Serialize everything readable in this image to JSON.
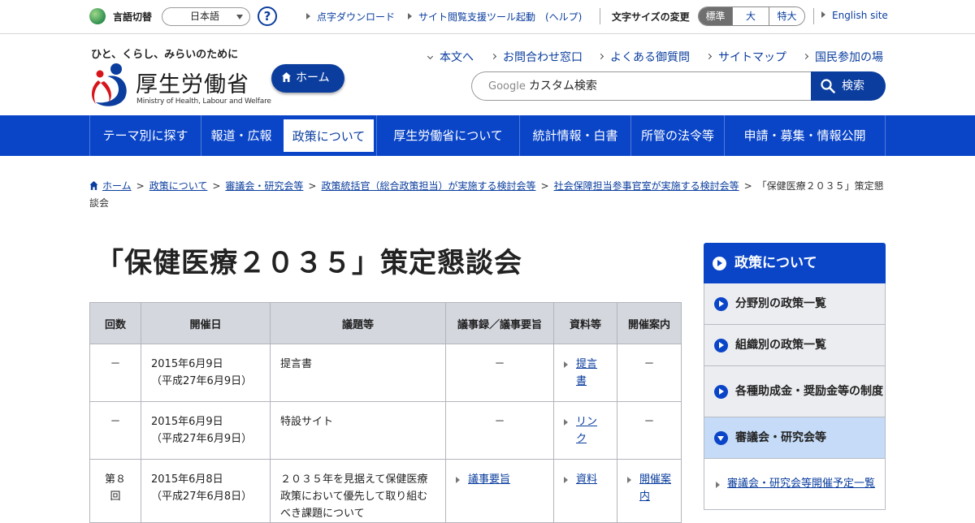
{
  "utility": {
    "language_label": "言語切替",
    "language_selected": "日本語",
    "help_symbol": "?",
    "links": [
      "点字ダウンロード",
      "サイト閲覧支援ツール起動　(ヘルプ)"
    ],
    "font_size_label": "文字サイズの変更",
    "font_sizes": [
      "標準",
      "大",
      "特大"
    ],
    "english_site": "English site"
  },
  "header": {
    "tagline": "ひと、くらし、みらいのために",
    "logo_jp": "厚生労働省",
    "logo_en": "Ministry of Health, Labour and Welfare",
    "home_button": "ホーム",
    "links": [
      "本文へ",
      "お問合わせ窓口",
      "よくある御質問",
      "サイトマップ",
      "国民参加の場"
    ],
    "search_brand": "Google",
    "search_value": "カスタム検索",
    "search_button": "検索"
  },
  "colors": {
    "primary": "#0a45c8",
    "dark_blue": "#0a3d9e",
    "table_header": "#d5d7df",
    "side_open": "#c5dbf7"
  },
  "nav": [
    "テーマ別に探す",
    "報道・広報",
    "政策について",
    "厚生労働省について",
    "統計情報・白書",
    "所管の法令等",
    "申請・募集・情報公開"
  ],
  "nav_active_index": 2,
  "breadcrumb": {
    "items": [
      "ホーム",
      "政策について",
      "審議会・研究会等",
      "政策統括官（総合政策担当）が実施する検討会等",
      "社会保障担当参事官室が実施する検討会等"
    ],
    "current": "「保健医療２０３５」策定懇談会",
    "separator": ">"
  },
  "page_title": "「保健医療２０３５」策定懇談会",
  "table": {
    "headers": [
      "回数",
      "開催日",
      "議題等",
      "議事録／議事要旨",
      "資料等",
      "開催案内"
    ],
    "rows": [
      {
        "no": "－",
        "date": "2015年6月9日",
        "date_era": "（平成27年6月9日）",
        "topic": "提言書",
        "minutes": "－",
        "materials": "提言書",
        "notice": "－"
      },
      {
        "no": "－",
        "date": "2015年6月9日",
        "date_era": "（平成27年6月9日）",
        "topic": "特設サイト",
        "minutes": "－",
        "materials": "リンク",
        "notice": "－"
      },
      {
        "no": "第８回",
        "date": "2015年6月8日",
        "date_era": "（平成27年6月8日）",
        "topic": "２０３５年を見据えて保健医療政策において優先して取り組むべき課題について",
        "minutes": "議事要旨",
        "materials": "資料",
        "notice": "開催案内"
      }
    ]
  },
  "sidenav": {
    "heading": "政策について",
    "items": [
      "分野別の政策一覧",
      "組織別の政策一覧",
      "各種助成金・奨励金等の制度",
      "審議会・研究会等"
    ],
    "sub_items": [
      "審議会・研究会等開催予定一覧"
    ]
  }
}
